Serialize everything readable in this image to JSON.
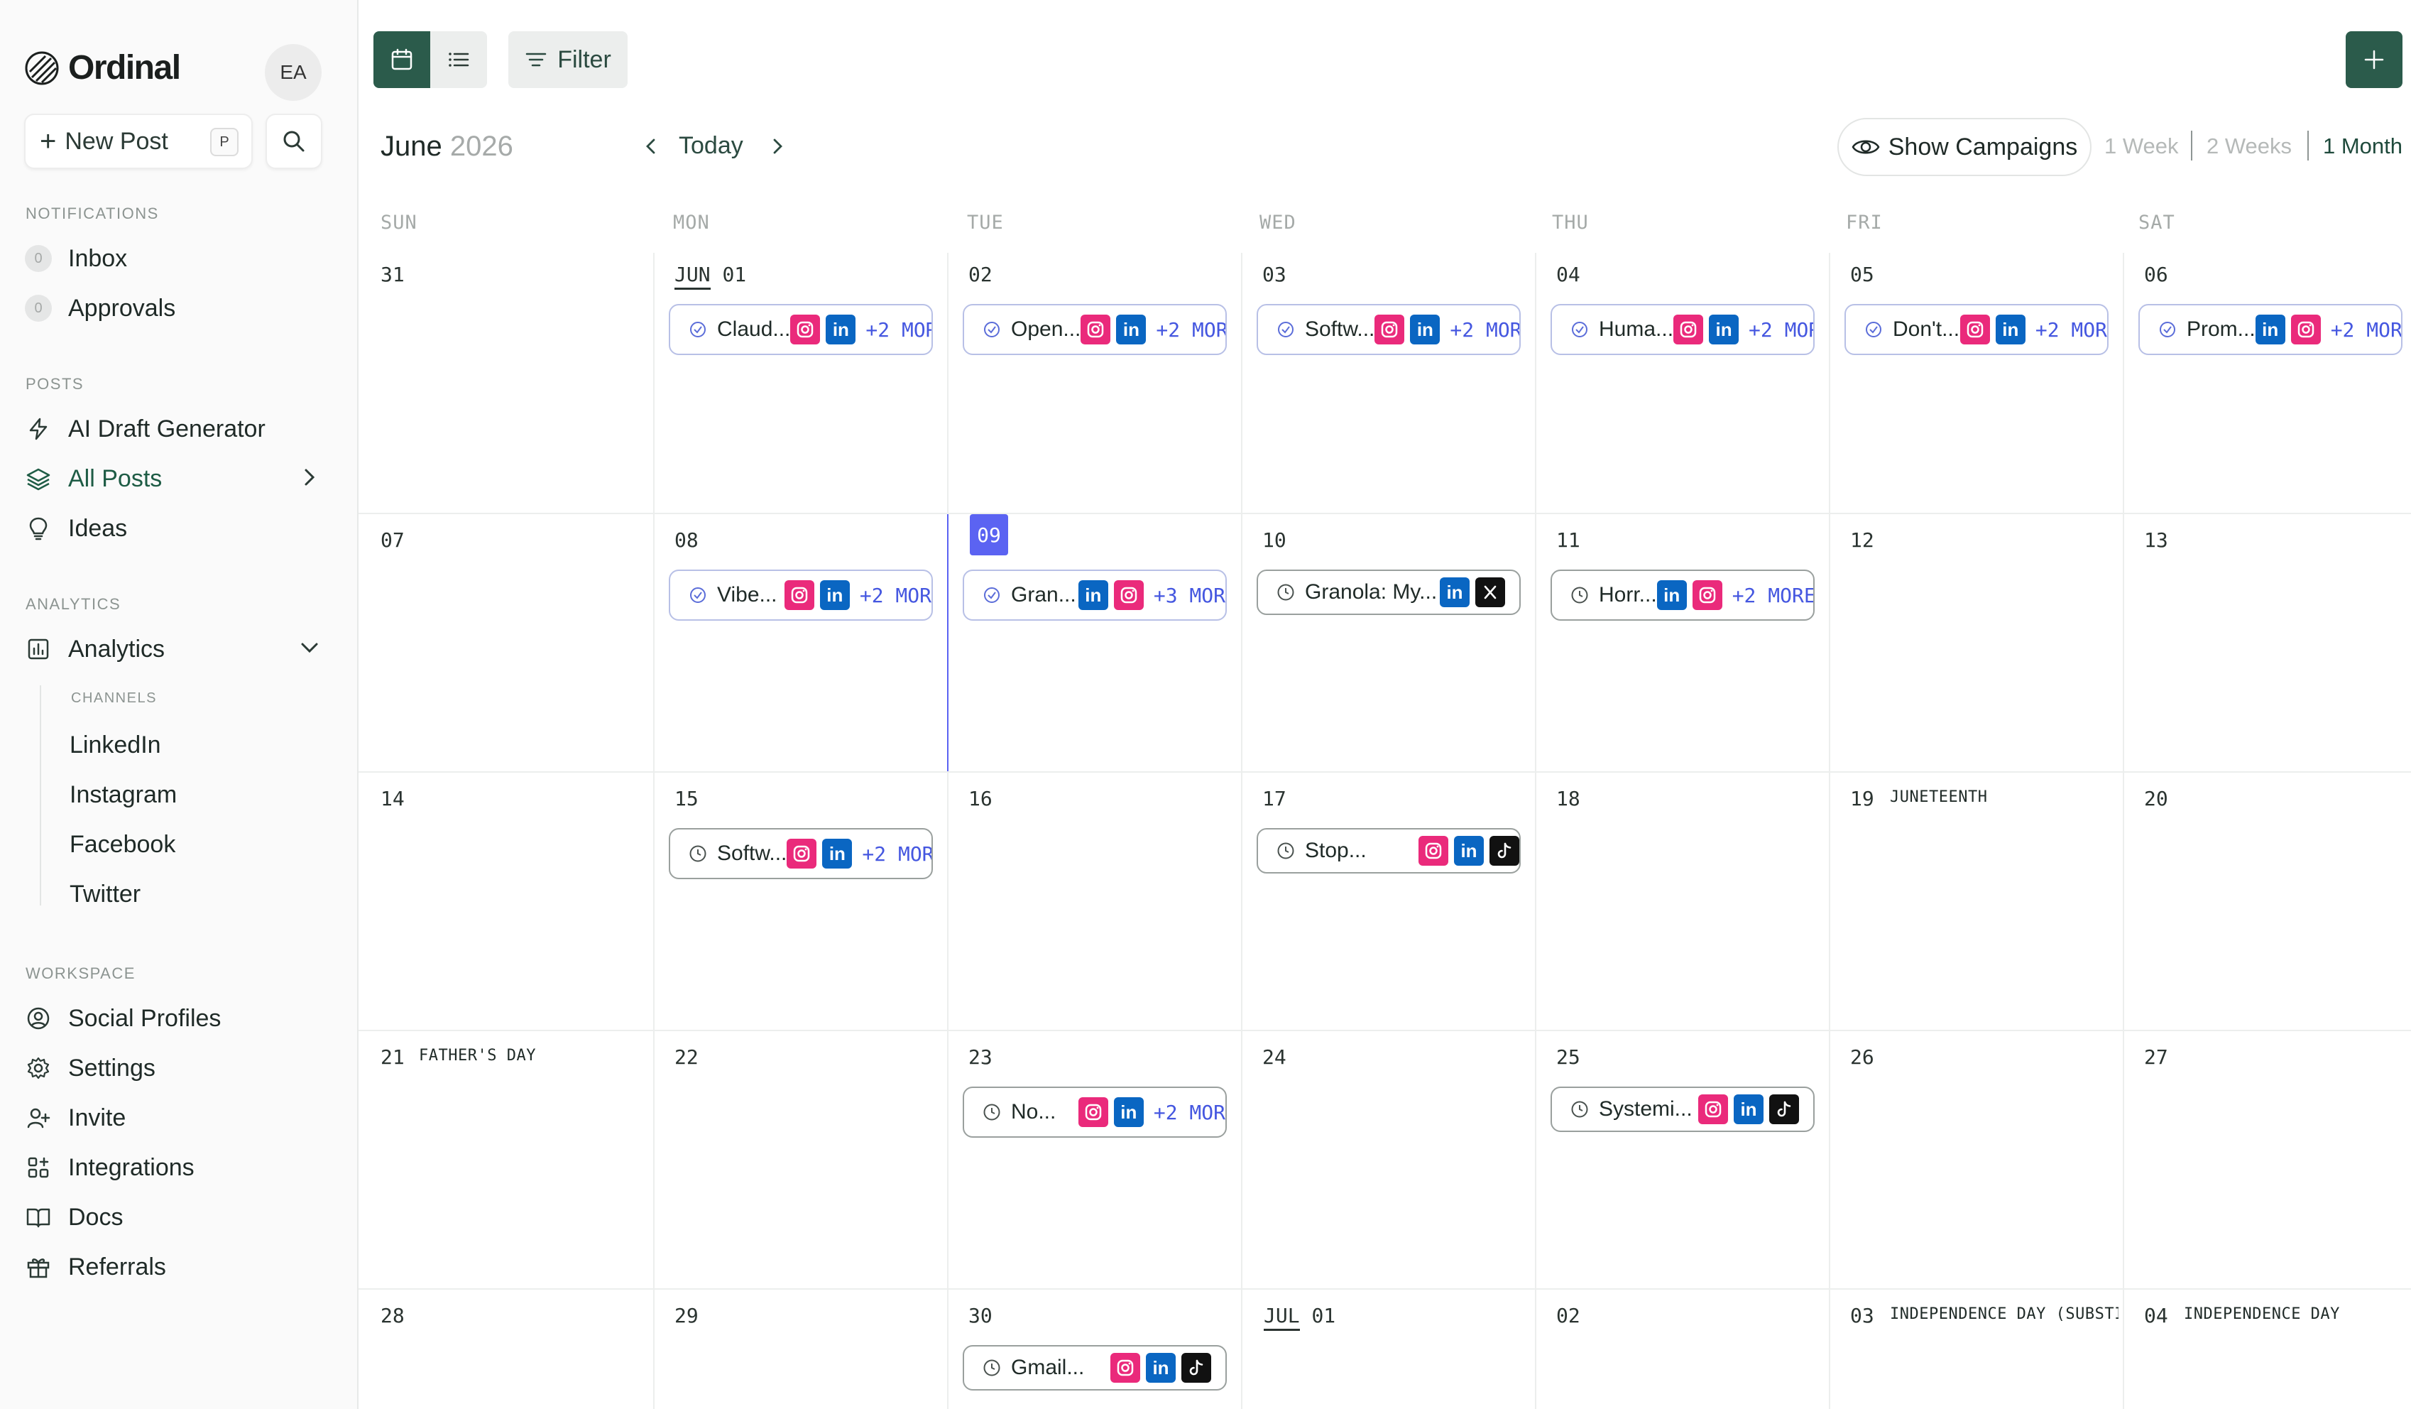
{
  "app": {
    "name": "Ordinal",
    "avatar_initials": "EA",
    "new_post_label": "New Post",
    "new_post_shortcut": "P"
  },
  "sidebar": {
    "sections": {
      "notifications": "NOTIFICATIONS",
      "posts": "POSTS",
      "analytics": "ANALYTICS",
      "channels": "CHANNELS",
      "workspace": "WORKSPACE"
    },
    "inbox": {
      "label": "Inbox",
      "count": "0"
    },
    "approvals": {
      "label": "Approvals",
      "count": "0"
    },
    "ai_draft": "AI Draft Generator",
    "all_posts": "All Posts",
    "ideas": "Ideas",
    "analytics": "Analytics",
    "channels": [
      "LinkedIn",
      "Instagram",
      "Facebook",
      "Twitter"
    ],
    "workspace": [
      "Social Profiles",
      "Settings",
      "Invite",
      "Integrations",
      "Docs",
      "Referrals"
    ]
  },
  "toolbar": {
    "filter_label": "Filter",
    "month": "June",
    "year": "2026",
    "today_label": "Today",
    "show_campaigns": "Show Campaigns",
    "ranges": [
      "1 Week",
      "2 Weeks",
      "1 Month"
    ],
    "active_range": "1 Month"
  },
  "calendar": {
    "weekdays": [
      "SUN",
      "MON",
      "TUE",
      "WED",
      "THU",
      "FRI",
      "SAT"
    ],
    "weeks": [
      [
        "31",
        "01",
        "02",
        "03",
        "04",
        "05",
        "06"
      ],
      [
        "07",
        "08",
        "09",
        "10",
        "11",
        "12",
        "13"
      ],
      [
        "14",
        "15",
        "16",
        "17",
        "18",
        "19",
        "20"
      ],
      [
        "21",
        "22",
        "23",
        "24",
        "25",
        "26",
        "27"
      ],
      [
        "28",
        "29",
        "30",
        "01",
        "02",
        "03",
        "04"
      ]
    ],
    "month_markers": {
      "jun": "JUN",
      "jul": "JUL"
    },
    "holidays": {
      "juneteenth": "JUNETEENTH",
      "fathers_day": "FATHER'S DAY",
      "independence_subst": "INDEPENDENCE DAY (SUBSTI",
      "independence": "INDEPENDENCE DAY"
    },
    "posts": [
      {
        "title": "Claud...",
        "more": "+2 MOR"
      },
      {
        "title": "Open...",
        "more": "+2 MOR"
      },
      {
        "title": "Softw...",
        "more": "+2 MOR"
      },
      {
        "title": "Huma...",
        "more": "+2 MOR"
      },
      {
        "title": "Don't...",
        "more": "+2 MOR"
      },
      {
        "title": "Prom...",
        "more": "+2 MOR"
      },
      {
        "title": "Vibe...",
        "more": "+2 MOR"
      },
      {
        "title": "Gran...",
        "more": "+3 MOR"
      },
      {
        "title": "Granola: My...",
        "more": ""
      },
      {
        "title": "Horr...",
        "more": "+2 MORE"
      },
      {
        "title": "Softw...",
        "more": "+2 MOR"
      },
      {
        "title": "Stop...",
        "more": ""
      },
      {
        "title": "No...",
        "more": "+2 MOR"
      },
      {
        "title": "Systemi...",
        "more": ""
      },
      {
        "title": "Gmail...",
        "more": ""
      }
    ]
  },
  "colors": {
    "brand_green": "#2b5b4b",
    "today_accent": "#5b63f2",
    "instagram": "#ea2a7b",
    "linkedin": "#0a66c2",
    "more_text": "#4557e0"
  }
}
